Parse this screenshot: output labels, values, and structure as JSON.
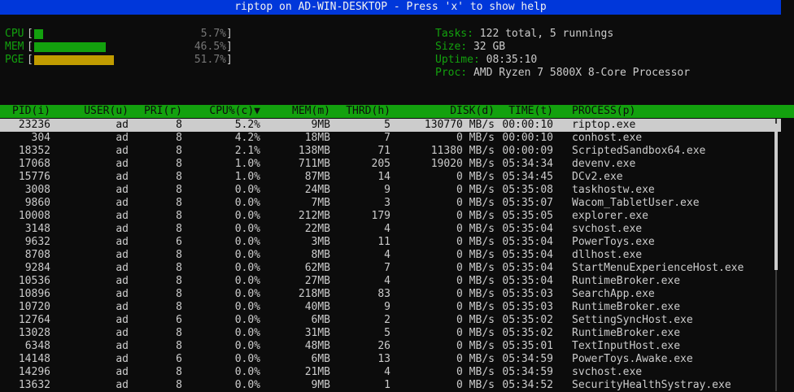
{
  "title": "riptop on AD-WIN-DESKTOP - Press 'x' to show help",
  "meters": [
    {
      "label": "CPU",
      "percent": 5.7,
      "display": "5.7%",
      "color": "#13a10e"
    },
    {
      "label": "MEM",
      "percent": 46.5,
      "display": "46.5%",
      "color": "#13a10e"
    },
    {
      "label": "PGE",
      "percent": 51.7,
      "display": "51.7%",
      "color": "#c19c00"
    }
  ],
  "info": {
    "tasks_label": "Tasks:",
    "tasks_value": "122 total, 5 runnings",
    "size_label": "Size:",
    "size_value": "32 GB",
    "uptime_label": "Uptime:",
    "uptime_value": "08:35:10",
    "proc_label": "Proc:",
    "proc_value": "AMD Ryzen 7 5800X 8-Core Processor"
  },
  "columns": [
    "PID(i)",
    "USER(u)",
    "PRI(r)",
    "CPU%(c)▼",
    "MEM(m)",
    "THRD(h)",
    "DISK(d)",
    "TIME(t)",
    "PROCESS(p)"
  ],
  "processes": [
    {
      "pid": "23236",
      "user": "ad",
      "pri": "8",
      "cpu": "5.2%",
      "mem": "9MB",
      "thrd": "5",
      "disk": "130770 MB/s",
      "time": "00:00:10",
      "name": "riptop.exe",
      "selected": true
    },
    {
      "pid": "304",
      "user": "ad",
      "pri": "8",
      "cpu": "4.2%",
      "mem": "18MB",
      "thrd": "7",
      "disk": "0 MB/s",
      "time": "00:00:10",
      "name": "conhost.exe"
    },
    {
      "pid": "18352",
      "user": "ad",
      "pri": "8",
      "cpu": "2.1%",
      "mem": "138MB",
      "thrd": "71",
      "disk": "11380 MB/s",
      "time": "00:00:09",
      "name": "ScriptedSandbox64.exe"
    },
    {
      "pid": "17068",
      "user": "ad",
      "pri": "8",
      "cpu": "1.0%",
      "mem": "711MB",
      "thrd": "205",
      "disk": "19020 MB/s",
      "time": "05:34:34",
      "name": "devenv.exe"
    },
    {
      "pid": "15776",
      "user": "ad",
      "pri": "8",
      "cpu": "1.0%",
      "mem": "87MB",
      "thrd": "14",
      "disk": "0 MB/s",
      "time": "05:34:45",
      "name": "DCv2.exe"
    },
    {
      "pid": "3008",
      "user": "ad",
      "pri": "8",
      "cpu": "0.0%",
      "mem": "24MB",
      "thrd": "9",
      "disk": "0 MB/s",
      "time": "05:35:08",
      "name": "taskhostw.exe"
    },
    {
      "pid": "9860",
      "user": "ad",
      "pri": "8",
      "cpu": "0.0%",
      "mem": "7MB",
      "thrd": "3",
      "disk": "0 MB/s",
      "time": "05:35:07",
      "name": "Wacom_TabletUser.exe"
    },
    {
      "pid": "10008",
      "user": "ad",
      "pri": "8",
      "cpu": "0.0%",
      "mem": "212MB",
      "thrd": "179",
      "disk": "0 MB/s",
      "time": "05:35:05",
      "name": "explorer.exe"
    },
    {
      "pid": "3148",
      "user": "ad",
      "pri": "8",
      "cpu": "0.0%",
      "mem": "22MB",
      "thrd": "4",
      "disk": "0 MB/s",
      "time": "05:35:04",
      "name": "svchost.exe"
    },
    {
      "pid": "9632",
      "user": "ad",
      "pri": "6",
      "cpu": "0.0%",
      "mem": "3MB",
      "thrd": "11",
      "disk": "0 MB/s",
      "time": "05:35:04",
      "name": "PowerToys.exe"
    },
    {
      "pid": "8708",
      "user": "ad",
      "pri": "8",
      "cpu": "0.0%",
      "mem": "8MB",
      "thrd": "4",
      "disk": "0 MB/s",
      "time": "05:35:04",
      "name": "dllhost.exe"
    },
    {
      "pid": "9284",
      "user": "ad",
      "pri": "8",
      "cpu": "0.0%",
      "mem": "62MB",
      "thrd": "7",
      "disk": "0 MB/s",
      "time": "05:35:04",
      "name": "StartMenuExperienceHost.exe"
    },
    {
      "pid": "10536",
      "user": "ad",
      "pri": "8",
      "cpu": "0.0%",
      "mem": "27MB",
      "thrd": "4",
      "disk": "0 MB/s",
      "time": "05:35:04",
      "name": "RuntimeBroker.exe"
    },
    {
      "pid": "10896",
      "user": "ad",
      "pri": "8",
      "cpu": "0.0%",
      "mem": "218MB",
      "thrd": "83",
      "disk": "0 MB/s",
      "time": "05:35:03",
      "name": "SearchApp.exe"
    },
    {
      "pid": "10720",
      "user": "ad",
      "pri": "8",
      "cpu": "0.0%",
      "mem": "40MB",
      "thrd": "9",
      "disk": "0 MB/s",
      "time": "05:35:03",
      "name": "RuntimeBroker.exe"
    },
    {
      "pid": "12764",
      "user": "ad",
      "pri": "6",
      "cpu": "0.0%",
      "mem": "6MB",
      "thrd": "2",
      "disk": "0 MB/s",
      "time": "05:35:02",
      "name": "SettingSyncHost.exe"
    },
    {
      "pid": "13028",
      "user": "ad",
      "pri": "8",
      "cpu": "0.0%",
      "mem": "31MB",
      "thrd": "5",
      "disk": "0 MB/s",
      "time": "05:35:02",
      "name": "RuntimeBroker.exe"
    },
    {
      "pid": "6348",
      "user": "ad",
      "pri": "8",
      "cpu": "0.0%",
      "mem": "48MB",
      "thrd": "26",
      "disk": "0 MB/s",
      "time": "05:35:01",
      "name": "TextInputHost.exe"
    },
    {
      "pid": "14148",
      "user": "ad",
      "pri": "6",
      "cpu": "0.0%",
      "mem": "6MB",
      "thrd": "13",
      "disk": "0 MB/s",
      "time": "05:34:59",
      "name": "PowerToys.Awake.exe"
    },
    {
      "pid": "14296",
      "user": "ad",
      "pri": "8",
      "cpu": "0.0%",
      "mem": "21MB",
      "thrd": "4",
      "disk": "0 MB/s",
      "time": "05:34:59",
      "name": "svchost.exe"
    },
    {
      "pid": "13632",
      "user": "ad",
      "pri": "8",
      "cpu": "0.0%",
      "mem": "9MB",
      "thrd": "1",
      "disk": "0 MB/s",
      "time": "05:34:52",
      "name": "SecurityHealthSystray.exe"
    }
  ]
}
